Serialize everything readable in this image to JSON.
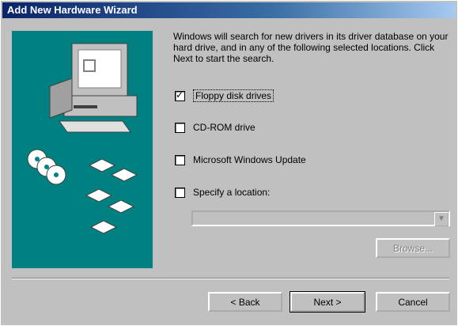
{
  "window": {
    "title": "Add New Hardware Wizard"
  },
  "intro_text": "Windows will search for new drivers in its driver database on your hard drive, and in any of the following selected locations. Click Next to start the search.",
  "options": [
    {
      "label": "Floppy disk drives",
      "checked": true
    },
    {
      "label": "CD-ROM drive",
      "checked": false
    },
    {
      "label": "Microsoft Windows Update",
      "checked": false
    },
    {
      "label": "Specify a location:",
      "checked": false
    }
  ],
  "location": {
    "value": ""
  },
  "browse_label": "Browse...",
  "buttons": {
    "back": "< Back",
    "next": "Next >",
    "cancel": "Cancel"
  }
}
